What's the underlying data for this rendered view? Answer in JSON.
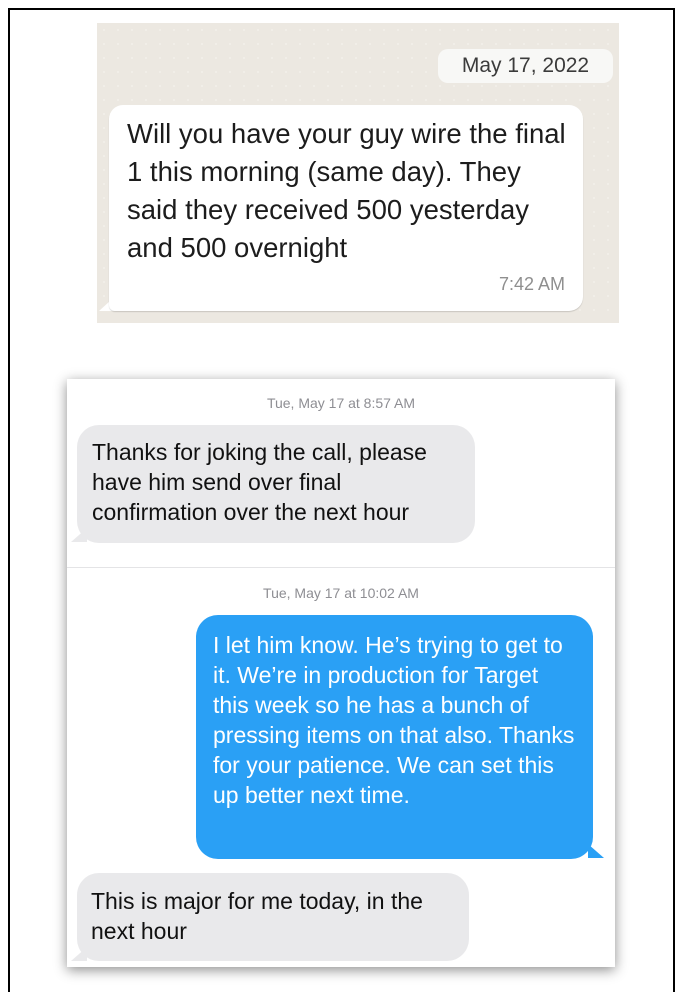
{
  "whatsapp": {
    "date_chip": "May 17, 2022",
    "message": "Will you have your guy wire the final 1 this morning (same day). They said they received 500 yesterday and 500 overnight",
    "time": "7:42 AM"
  },
  "imessage": {
    "thread": [
      {
        "timestamp": "Tue, May 17 at 8:57 AM"
      },
      {
        "message": "Thanks for joking the call, please have him send over final confirmation over the next hour",
        "direction": "incoming"
      },
      {
        "timestamp": "Tue, May 17 at 10:02 AM"
      },
      {
        "message": "I let him know. He’s trying to get to it. We’re in production for Target this week so he has a bunch of pressing items on that also. Thanks for your patience. We can set this up better next time.",
        "direction": "outgoing"
      },
      {
        "message": "This is major for me today, in the next hour",
        "direction": "incoming"
      }
    ]
  },
  "colors": {
    "outgoing_bubble": "#2aa0f5",
    "incoming_bubble": "#e9e9eb",
    "whatsapp_background": "#ece8e1"
  }
}
